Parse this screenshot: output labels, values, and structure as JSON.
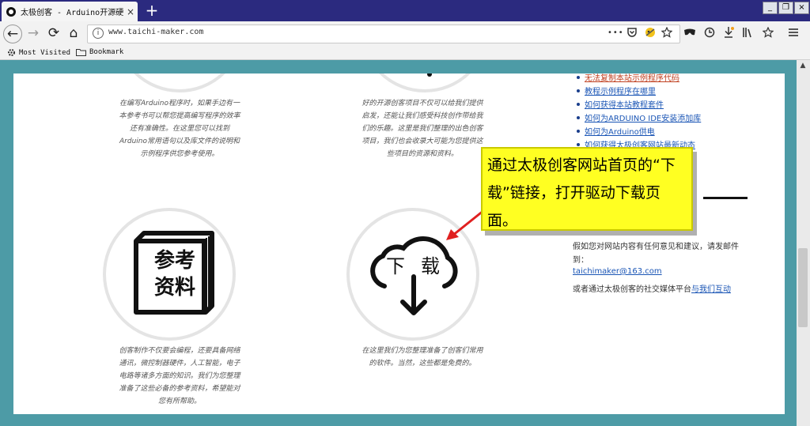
{
  "tab": {
    "title": "太极创客 - Arduino开源硬件",
    "close": "×",
    "new_tab": "+"
  },
  "window": {
    "minimize": "_",
    "restore": "❐",
    "close": "×"
  },
  "nav": {
    "back": "←",
    "forward": "→",
    "reload": "⟳",
    "home": "⌂",
    "url": "www.taichi-maker.com",
    "menu": "•••"
  },
  "bookmarks": [
    {
      "label": "Most Visited"
    },
    {
      "label": "Bookmark"
    }
  ],
  "left_column": {
    "top_desc": [
      "在编写Arduino程序时，如果手边有一",
      "本参考书可以帮您提高编写程序的效率",
      "还有准确性。在这里您可以找到",
      "Arduino常用语句以及库文件的说明和",
      "示例程序供您参考使用。"
    ],
    "book_text_1": "参考",
    "book_text_2": "资料",
    "bottom_desc": [
      "创客制作不仅要会编程，还要具备网络",
      "通讯，微控制器硬件，人工智能，电子",
      "电路等诸多方面的知识。我们为您整理",
      "准备了这些必备的参考资料，希望能对",
      "您有所帮助。"
    ]
  },
  "middle_column": {
    "top_desc": [
      "好的开源创客项目不仅可以给我们提供",
      "启发，还能让我们感受科技创作带给我",
      "们的乐趣。这里是我们整理的出色创客",
      "项目，我们也会收录大可能为您提供这",
      "些项目的资源和资料。"
    ],
    "cloud_text_1": "下",
    "cloud_text_2": "载",
    "bottom_desc": [
      "在这里我们为您整理准备了创客们常用",
      "的软件。当然，这些都是免费的。"
    ]
  },
  "right_column": {
    "links": [
      "无法复制本站示例程序代码",
      "教程示例程序在哪里",
      "如何获得本站教程套件",
      "如何为ARDUINO IDE安装添加库",
      "如何为Arduino供电",
      "如何获得太极创客网站最新动态"
    ],
    "feedback_line1": "假如您对网站内容有任何意见和建议，请发邮件",
    "feedback_line2": "到：",
    "email": "taichimaker@163.com",
    "social_prefix": "或者通过太极创客的社交媒体平台",
    "social_link": "与我们互动"
  },
  "callout": {
    "text": "通过太极创客网站首页的“下载”链接，打开驱动下载页面。"
  },
  "colors": {
    "accent": "#4d9ba6",
    "callout_bg": "#ffff22",
    "arrow": "#e02020",
    "link": "#1a55b5"
  }
}
